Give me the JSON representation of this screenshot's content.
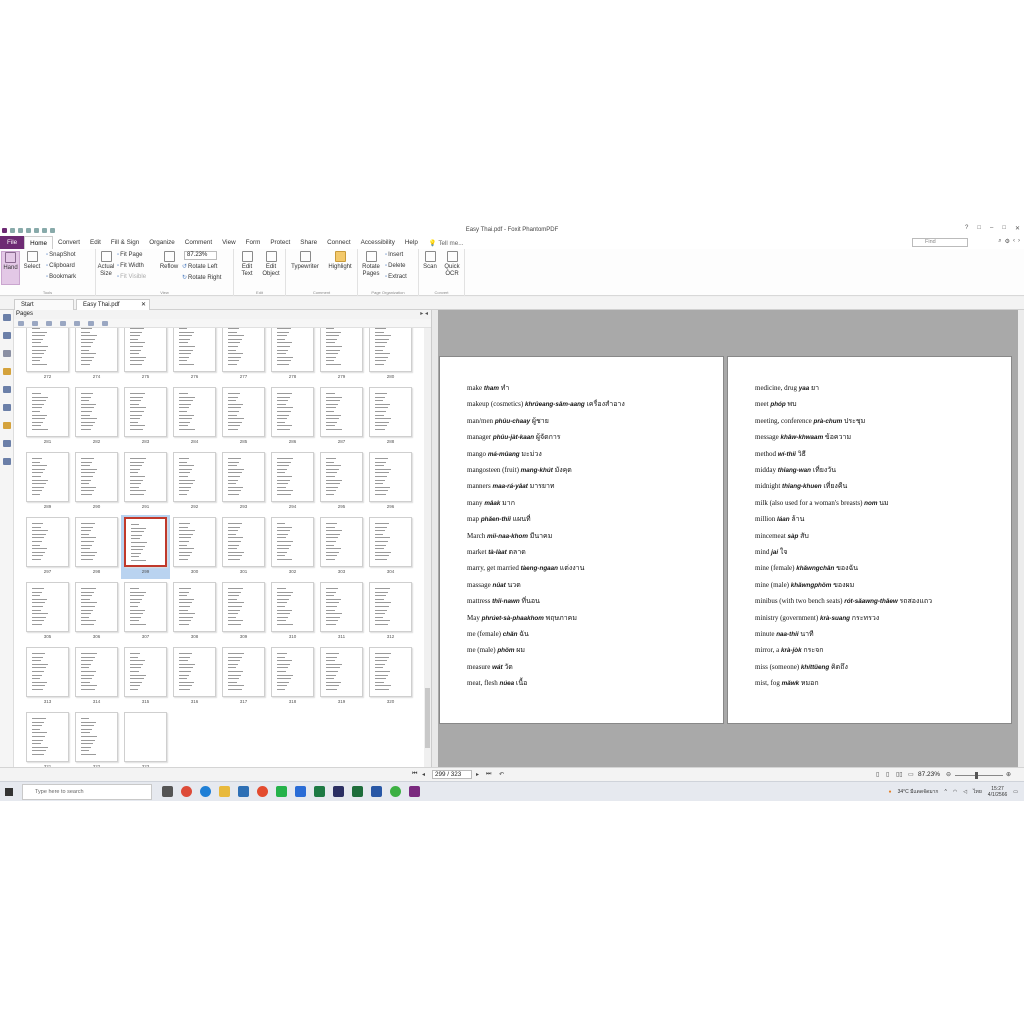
{
  "window": {
    "title": "Easy Thai.pdf - Foxit PhantomPDF",
    "controls": [
      "?",
      "□",
      "–",
      "□",
      "✕"
    ]
  },
  "menu": {
    "file": "File",
    "tabs": [
      "Home",
      "Convert",
      "Edit",
      "Fill & Sign",
      "Organize",
      "Comment",
      "View",
      "Form",
      "Protect",
      "Share",
      "Connect",
      "Accessibility",
      "Help"
    ],
    "tell_me": "Tell me...",
    "find_placeholder": "Find"
  },
  "ribbon": {
    "hand": "Hand",
    "select": "Select",
    "snapshot": "SnapShot",
    "clipboard": "Clipboard",
    "bookmark": "Bookmark",
    "actual_size": [
      "Actual",
      "Size"
    ],
    "fit_page": "Fit Page",
    "fit_width": "Fit Width",
    "fit_visible": "Fit Visible",
    "reflow": "Reflow",
    "zoom": "87.23%",
    "rotate_left": "Rotate Left",
    "rotate_right": "Rotate Right",
    "edit_text": [
      "Edit",
      "Text"
    ],
    "edit_object": [
      "Edit",
      "Object"
    ],
    "typewriter": "Typewriter",
    "highlight": "Highlight",
    "rotate_pages": [
      "Rotate",
      "Pages"
    ],
    "insert": "Insert",
    "delete": "Delete",
    "extract": "Extract",
    "scan": "Scan",
    "quick_ocr": [
      "Quick",
      "OCR"
    ],
    "groups": [
      "Tools",
      "View",
      "Edit",
      "Comment",
      "Page Organization",
      "Convert"
    ]
  },
  "doc_tabs": {
    "start": "Start",
    "file": "Easy Thai.pdf"
  },
  "panel": {
    "title": "Pages",
    "controls": "▸ ◂",
    "selected_page": "299",
    "rows": [
      [
        "272",
        "274",
        "275",
        "276",
        "277",
        "278",
        "279",
        "280"
      ],
      [
        "281",
        "282",
        "283",
        "284",
        "285",
        "286",
        "287",
        "288"
      ],
      [
        "289",
        "290",
        "291",
        "292",
        "293",
        "294",
        "295",
        "296"
      ],
      [
        "297",
        "298",
        "299",
        "300",
        "301",
        "302",
        "303",
        "304"
      ],
      [
        "305",
        "306",
        "307",
        "308",
        "309",
        "310",
        "311",
        "312"
      ],
      [
        "313",
        "314",
        "315",
        "316",
        "317",
        "318",
        "319",
        "320"
      ],
      [
        "321",
        "322",
        "323"
      ]
    ]
  },
  "left_page": [
    {
      "en": "make",
      "th": "tham",
      "thai": "ทำ"
    },
    {
      "en": "makeup (cosmetics)",
      "th": "khrûeang-sǎm-aang",
      "thai": "เครื่องสำอาง"
    },
    {
      "en": "man/men",
      "th": "phûu-chaay",
      "thai": "ผู้ชาย"
    },
    {
      "en": "manager",
      "th": "phûu-jàt-kaan",
      "thai": "ผู้จัดการ"
    },
    {
      "en": "mango",
      "th": "má-mûang",
      "thai": "มะม่วง"
    },
    {
      "en": "mangosteen (fruit)",
      "th": "mang-khút",
      "thai": "มังคุด"
    },
    {
      "en": "manners",
      "th": "maa-rá-yâat",
      "thai": "มารยาท"
    },
    {
      "en": "many",
      "th": "mâak",
      "thai": "มาก"
    },
    {
      "en": "map",
      "th": "phǎen-thîi",
      "thai": "แผนที่"
    },
    {
      "en": "March",
      "th": "mii-naa-khom",
      "thai": "มีนาคม"
    },
    {
      "en": "market",
      "th": "tà-làat",
      "thai": "ตลาด"
    },
    {
      "en": "marry, get married",
      "th": "tàeng-ngaan",
      "thai": "แต่งงาน"
    },
    {
      "en": "massage",
      "th": "nûat",
      "thai": "นวด"
    },
    {
      "en": "mattress",
      "th": "thîi-nawn",
      "thai": "ที่นอน"
    },
    {
      "en": "May",
      "th": "phrúet-sà-phaakhom",
      "thai": "พฤษภาคม"
    },
    {
      "en": "me (female)",
      "th": "chǎn",
      "thai": "ฉัน"
    },
    {
      "en": "me (male)",
      "th": "phǒm",
      "thai": "ผม"
    },
    {
      "en": "measure",
      "th": "wát",
      "thai": "วัด"
    },
    {
      "en": "meat, flesh",
      "th": "núea",
      "thai": "เนื้อ"
    }
  ],
  "right_page": [
    {
      "en": "medicine, drug",
      "th": "yaa",
      "thai": "ยา"
    },
    {
      "en": "meet",
      "th": "phóp",
      "thai": "พบ"
    },
    {
      "en": "meeting, conference",
      "th": "prà-chum",
      "thai": "ประชุม"
    },
    {
      "en": "message",
      "th": "khâw-khwaam",
      "thai": "ข้อความ"
    },
    {
      "en": "method",
      "th": "wí-thii",
      "thai": "วิธี"
    },
    {
      "en": "midday",
      "th": "thîang-wan",
      "thai": "เที่ยงวัน"
    },
    {
      "en": "midnight",
      "th": "thîang-khuen",
      "thai": "เที่ยงคืน"
    },
    {
      "en": "milk (also used for a woman's breasts)",
      "th": "nom",
      "thai": "นม"
    },
    {
      "en": "million",
      "th": "láan",
      "thai": "ล้าน"
    },
    {
      "en": "mincemeat",
      "th": "sàp",
      "thai": "สับ"
    },
    {
      "en": "mind",
      "th": "jai",
      "thai": "ใจ"
    },
    {
      "en": "mine (female)",
      "th": "khǎwngchǎn",
      "thai": "ของฉัน"
    },
    {
      "en": "mine (male)",
      "th": "khǎwngphǒm",
      "thai": "ของผม"
    },
    {
      "en": "minibus (with two bench seats)",
      "th": "rót-sǎawng-thǎew",
      "thai": "รถสองแถว"
    },
    {
      "en": "ministry (government)",
      "th": "krà-suang",
      "thai": "กระทรวง"
    },
    {
      "en": "minute",
      "th": "naa-thii",
      "thai": "นาที"
    },
    {
      "en": "mirror, a",
      "th": "krà-jòk",
      "thai": "กระจก"
    },
    {
      "en": "miss (someone)",
      "th": "khíttǔeng",
      "thai": "คิดถึง"
    },
    {
      "en": "mist, fog",
      "th": "mǎwk",
      "thai": "หมอก"
    }
  ],
  "status": {
    "page_indicator": "299 / 323",
    "zoom": "87.23%"
  },
  "taskbar": {
    "search_placeholder": "Type here to search",
    "tray_text": "34°C มีแดดจัดมาก",
    "lang": "ไทย",
    "time": "15:27",
    "date": "4/1/2566"
  }
}
